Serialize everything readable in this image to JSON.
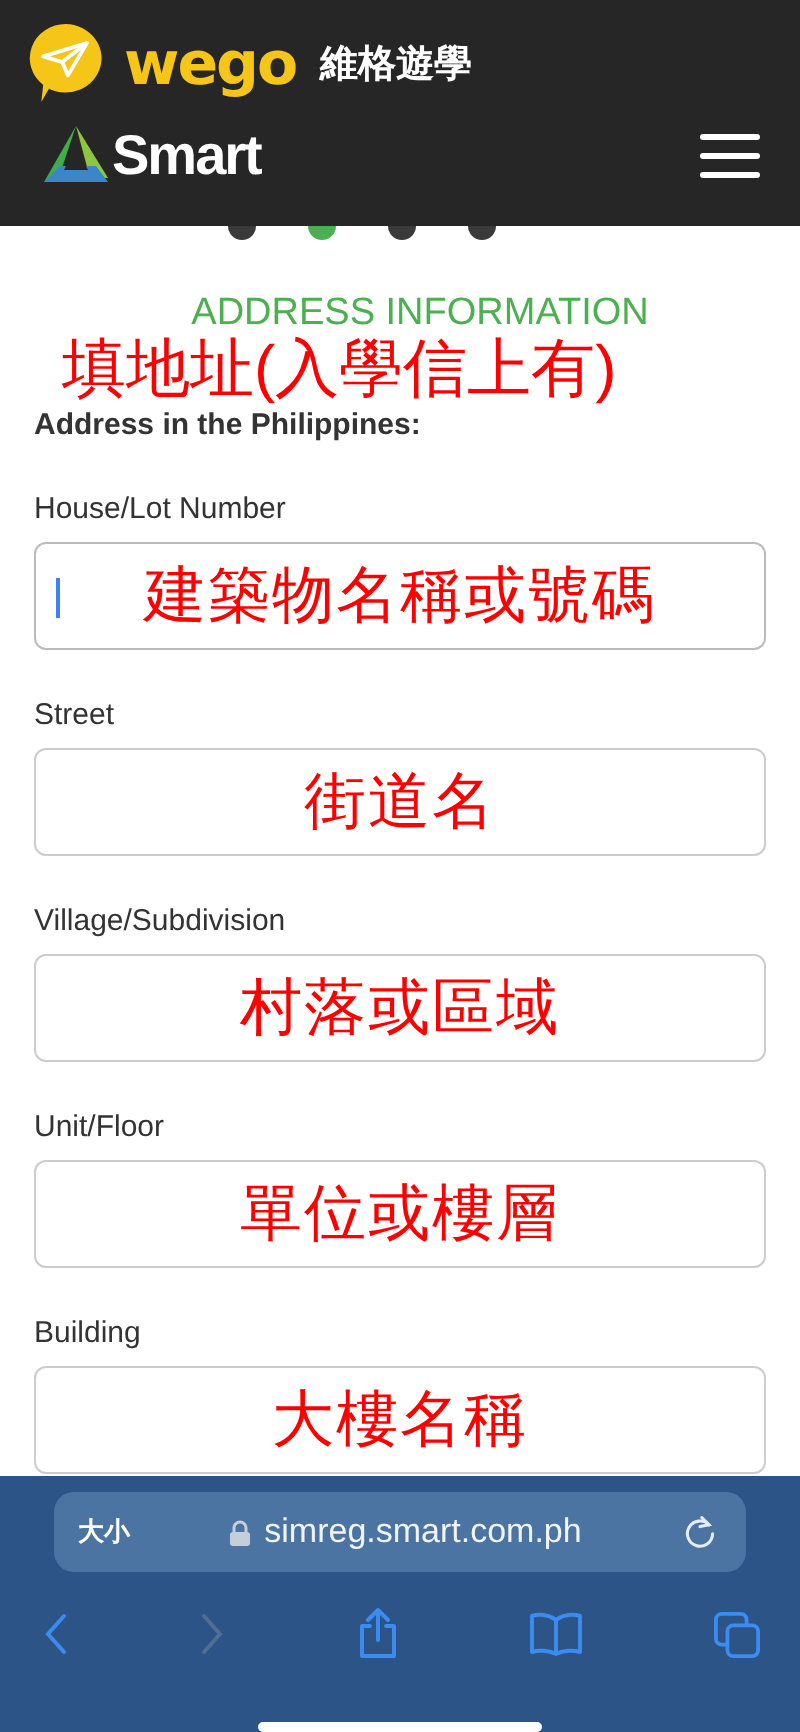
{
  "header": {
    "brand": "wego",
    "brand_subtitle": "維格遊學",
    "site_logo": "Smart"
  },
  "steps": [
    {
      "selected": false
    },
    {
      "selected": true
    },
    {
      "selected": false
    },
    {
      "selected": false
    }
  ],
  "section_title": "ADDRESS INFORMATION",
  "section_note": "填地址(入學信上有)",
  "group_label": "Address in the Philippines:",
  "fields": [
    {
      "label": "House/Lot Number",
      "note": "建築物名稱或號碼",
      "focused": true
    },
    {
      "label": "Street",
      "note": "街道名",
      "focused": false
    },
    {
      "label": "Village/Subdivision",
      "note": "村落或區域",
      "focused": false
    },
    {
      "label": "Unit/Floor",
      "note": "單位或樓層",
      "focused": false
    },
    {
      "label": "Building",
      "note": "大樓名稱",
      "focused": false
    }
  ],
  "browser": {
    "text_size": "大小",
    "url": "simreg.smart.com.ph"
  }
}
